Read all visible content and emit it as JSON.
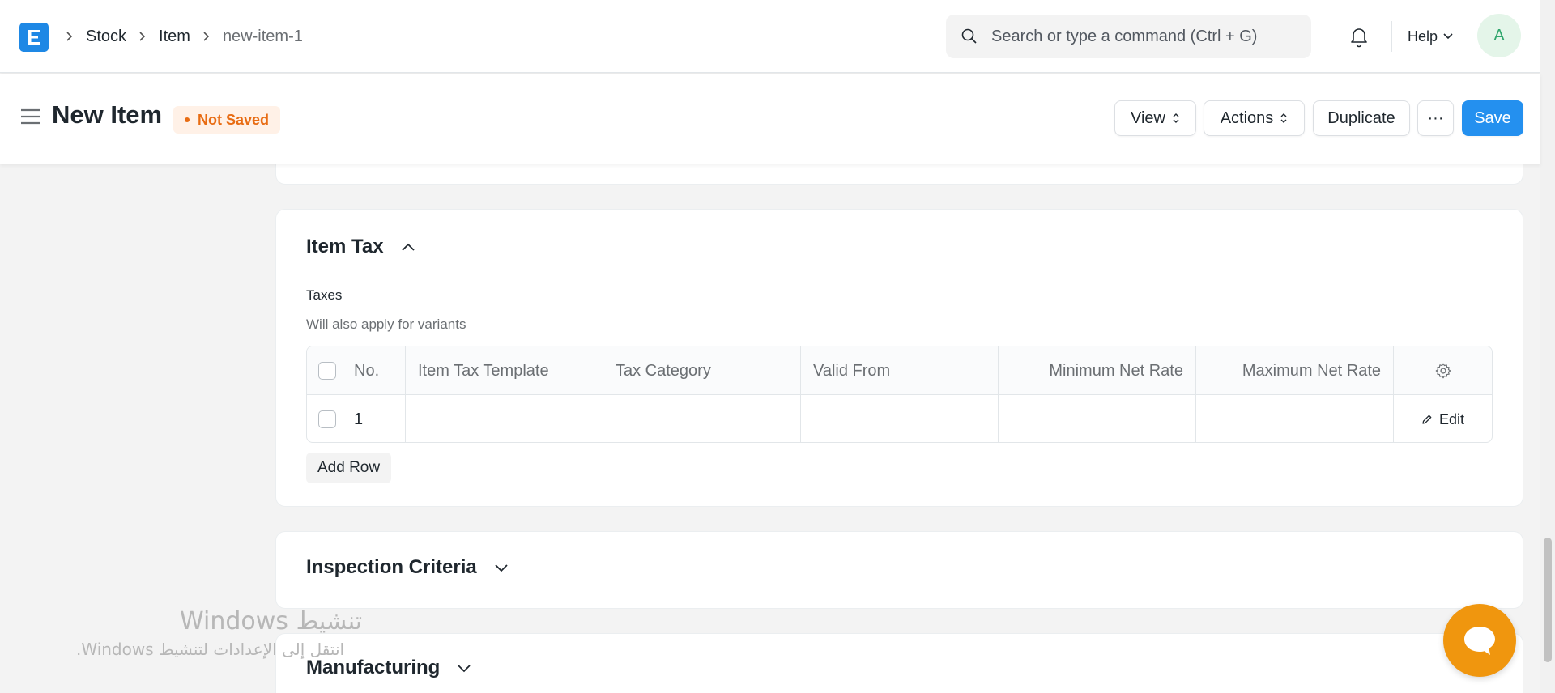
{
  "navbar": {
    "logo_letter": "E",
    "breadcrumbs": [
      "Stock",
      "Item",
      "new-item-1"
    ],
    "search_placeholder": "Search or type a command (Ctrl + G)",
    "help_label": "Help",
    "avatar_initial": "A"
  },
  "page_head": {
    "title": "New Item",
    "status_badge": "Not Saved",
    "buttons": {
      "view": "View",
      "actions": "Actions",
      "duplicate": "Duplicate",
      "more": "···",
      "save": "Save"
    }
  },
  "sections": {
    "item_tax": {
      "title": "Item Tax",
      "field_label": "Taxes",
      "field_description": "Will also apply for variants",
      "columns": [
        "No.",
        "Item Tax Template",
        "Tax Category",
        "Valid From",
        "Minimum Net Rate",
        "Maximum Net Rate"
      ],
      "rows": [
        {
          "no": "1",
          "item_tax_template": "",
          "tax_category": "",
          "valid_from": "",
          "minimum_net_rate": "",
          "maximum_net_rate": ""
        }
      ],
      "edit_label": "Edit",
      "add_row_label": "Add Row"
    },
    "inspection_criteria": {
      "title": "Inspection Criteria"
    },
    "manufacturing": {
      "title": "Manufacturing"
    }
  },
  "watermark": {
    "title": "تنشيط Windows",
    "subtitle": "انتقل إلى الإعدادات لتنشيط Windows."
  },
  "colors": {
    "primary": "#2490ef",
    "logo": "#1e88e5",
    "status_orange": "#e86c13",
    "chat": "#f0960e",
    "avatar_green": "#30a66d"
  }
}
